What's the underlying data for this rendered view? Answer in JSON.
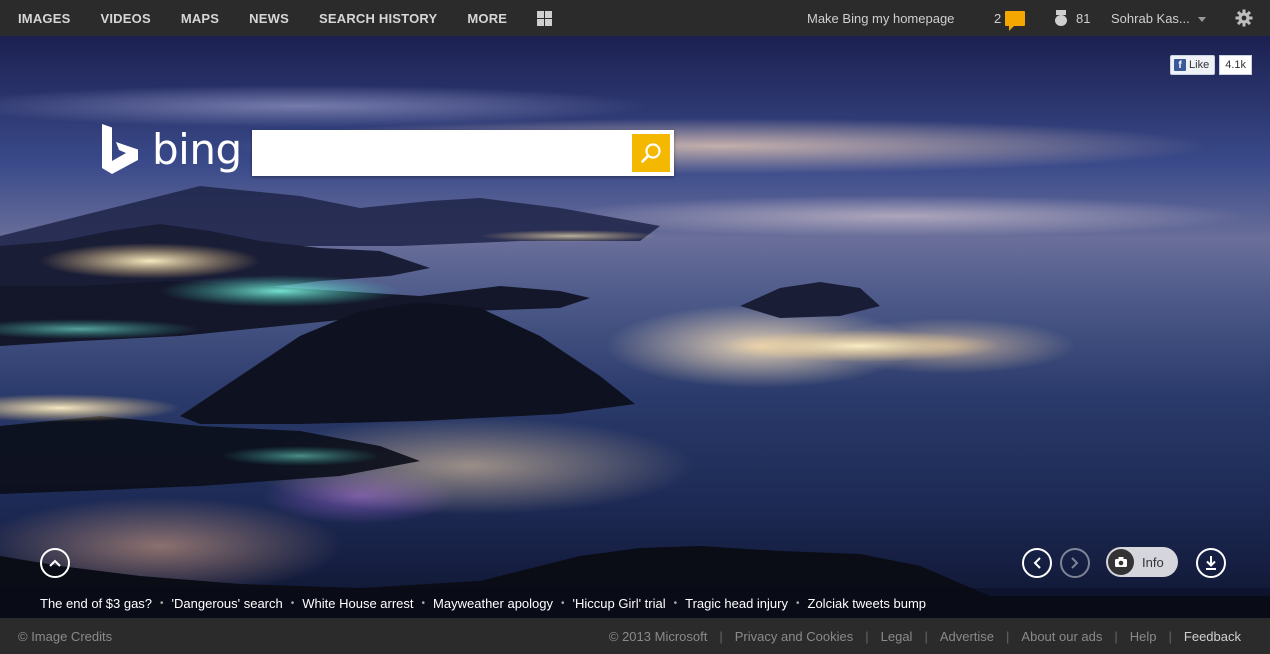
{
  "topbar": {
    "nav": [
      "IMAGES",
      "VIDEOS",
      "MAPS",
      "NEWS",
      "SEARCH HISTORY",
      "MORE"
    ],
    "homepage_link": "Make Bing my homepage",
    "messages_count": "2",
    "rewards_points": "81",
    "user_name": "Sohrab Kas..."
  },
  "facebook": {
    "like_label": "Like",
    "count": "4.1k"
  },
  "brand": {
    "name": "bing"
  },
  "search": {
    "value": "",
    "placeholder": ""
  },
  "hero": {
    "info_label": "Info"
  },
  "news": [
    "The end of $3 gas?",
    "'Dangerous' search",
    "White House arrest",
    "Mayweather apology",
    "'Hiccup Girl' trial",
    "Tragic head injury",
    "Zolciak tweets bump"
  ],
  "footer": {
    "image_credits": "© Image Credits",
    "copyright": "© 2013 Microsoft",
    "links": [
      "Privacy and Cookies",
      "Legal",
      "Advertise",
      "About our ads",
      "Help"
    ],
    "feedback": "Feedback"
  },
  "colors": {
    "accent": "#f4b800",
    "bar": "#2b2b2b",
    "notification": "#f4a700"
  },
  "icons": [
    "apps-grid-icon",
    "chat-bubble-icon",
    "medal-icon",
    "gear-icon",
    "search-icon",
    "collapse-up-icon",
    "previous-icon",
    "next-icon",
    "camera-icon",
    "download-icon",
    "facebook-icon"
  ]
}
